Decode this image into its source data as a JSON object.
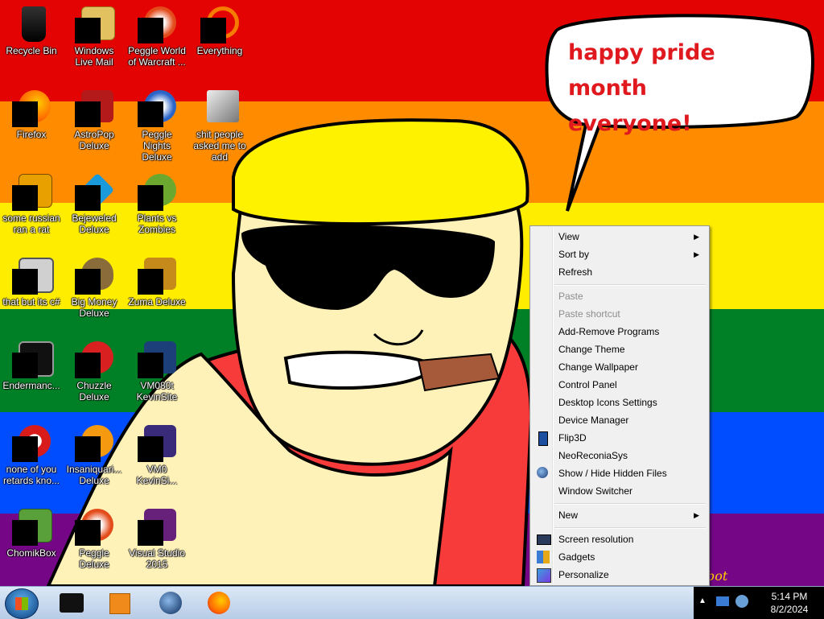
{
  "wallpaper": {
    "stripes": [
      "#e40303",
      "#ff8c00",
      "#ffed00",
      "#008026",
      "#004dff",
      "#750787"
    ],
    "bubble_text_line1": "happy pride month",
    "bubble_text_line2": "everyone!",
    "corner_text": "bot"
  },
  "desktop_icons": [
    {
      "label": "Recycle Bin",
      "icon": "recycle-bin-icon"
    },
    {
      "label": "Windows Live Mail",
      "icon": "mail-icon"
    },
    {
      "label": "Peggle World of Warcraft ...",
      "icon": "peggle-icon"
    },
    {
      "label": "Everything",
      "icon": "search-magnifier-icon"
    },
    {
      "label": "Firefox",
      "icon": "firefox-icon"
    },
    {
      "label": "AstroPop Deluxe",
      "icon": "astropop-icon"
    },
    {
      "label": "Peggle Nights Deluxe",
      "icon": "peggle-nights-icon"
    },
    {
      "label": "shit people asked me to add",
      "icon": "folder-icon"
    },
    {
      "label": "some russian ran a rat",
      "icon": "game-icon"
    },
    {
      "label": "Bejeweled Deluxe",
      "icon": "bejeweled-icon"
    },
    {
      "label": "Plants vs Zombies",
      "icon": "plants-vs-zombies-icon"
    },
    {
      "label": "that but its c#",
      "icon": "window-stack-icon"
    },
    {
      "label": "Big Money Deluxe",
      "icon": "money-bag-icon"
    },
    {
      "label": "Zuma Deluxe",
      "icon": "zuma-icon"
    },
    {
      "label": "Endermanc...",
      "icon": "console-icon"
    },
    {
      "label": "Chuzzle Deluxe",
      "icon": "chuzzle-icon"
    },
    {
      "label": "VM080t KevinSite",
      "icon": "vm-icon"
    },
    {
      "label": "none of you retards kno...",
      "icon": "red-circle-icon"
    },
    {
      "label": "Insaniquari... Deluxe",
      "icon": "insaniquarium-icon"
    },
    {
      "label": "VM0 KevinSi...",
      "icon": "vm-icon"
    },
    {
      "label": "ChomikBox",
      "icon": "chomikbox-icon"
    },
    {
      "label": "Peggle Deluxe",
      "icon": "peggle-icon"
    },
    {
      "label": "Visual Studio 2015",
      "icon": "visual-studio-icon"
    }
  ],
  "context_menu": {
    "view": "View",
    "sort_by": "Sort by",
    "refresh": "Refresh",
    "paste": "Paste",
    "paste_shortcut": "Paste shortcut",
    "add_remove": "Add-Remove Programs",
    "change_theme": "Change Theme",
    "change_wallpaper": "Change Wallpaper",
    "control_panel": "Control Panel",
    "desktop_icons_settings": "Desktop Icons Settings",
    "device_manager": "Device Manager",
    "flip3d": "Flip3D",
    "neoreconiasys": "NeoReconiaSys",
    "show_hide": "Show / Hide Hidden Files",
    "window_switcher": "Window Switcher",
    "new": "New",
    "screen_resolution": "Screen resolution",
    "gadgets": "Gadgets",
    "personalize": "Personalize"
  },
  "taskbar": {
    "time": "5:14 PM",
    "date": "8/2/2024"
  }
}
